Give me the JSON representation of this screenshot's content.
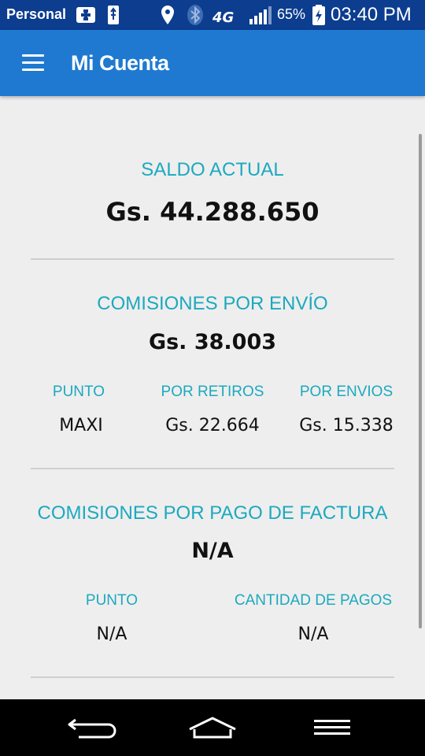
{
  "status_bar": {
    "carrier": "Personal",
    "battery_percent": "65%",
    "time": "03:40 PM",
    "icons": [
      "medical-cross-icon",
      "usb-icon",
      "location-icon",
      "bluetooth-icon",
      "network-4g-icon",
      "signal-icon",
      "battery-charging-icon"
    ]
  },
  "app_bar": {
    "title": "Mi Cuenta",
    "menu_icon": "hamburger-menu-icon",
    "color": "#1f79d0"
  },
  "saldo": {
    "label": "SALDO ACTUAL",
    "value": "Gs. 44.288.650"
  },
  "comisiones_envio": {
    "label": "COMISIONES POR ENVÍO",
    "value": "Gs. 38.003",
    "columns": [
      {
        "header": "PUNTO",
        "value": "MAXI"
      },
      {
        "header": "POR RETIROS",
        "value": "Gs. 22.664"
      },
      {
        "header": "POR ENVIOS",
        "value": "Gs. 15.338"
      }
    ]
  },
  "comisiones_factura": {
    "label": "COMISIONES POR PAGO DE FACTURA",
    "value": "N/A",
    "columns": [
      {
        "header": "PUNTO",
        "value": "N/A"
      },
      {
        "header": "CANTIDAD DE PAGOS",
        "value": "N/A"
      }
    ]
  },
  "nav_bar": {
    "buttons": [
      "back-icon",
      "home-icon",
      "menu-icon"
    ]
  },
  "colors": {
    "status_bar": "#0c3d8f",
    "accent_label": "#1ca9bf",
    "background": "#eeeeee"
  }
}
